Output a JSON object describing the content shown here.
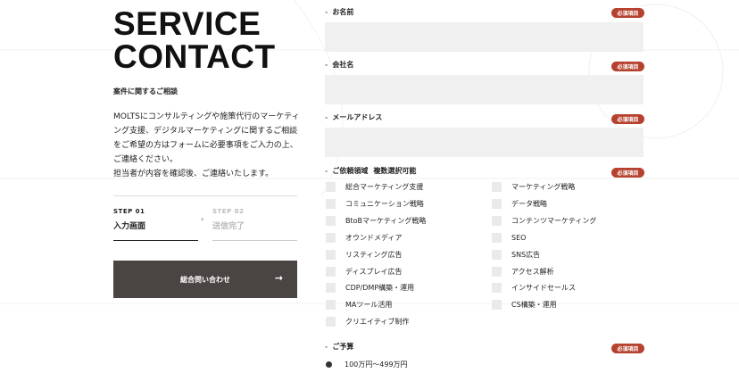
{
  "heading": {
    "line1": "SERVICE",
    "line2": "CONTACT"
  },
  "subtitle": "案件に関するご相談",
  "description": {
    "p1": "MOLTSにコンサルティングや施策代行のマーケティング支援、デジタルマーケティングに関するご相談をご希望の方はフォームに必要事項をご入力の上、ご連絡ください。",
    "p2": "担当者が内容を確認後、ご連絡いたします。"
  },
  "steps": [
    {
      "no": "STEP 01",
      "name": "入力画面"
    },
    {
      "no": "STEP 02",
      "name": "送信完了"
    }
  ],
  "submit": {
    "label": "総合問い合わせ",
    "icon": "arrow-right-icon"
  },
  "required_label": "必須項目",
  "fields": {
    "name": {
      "label": "お名前",
      "value": ""
    },
    "company": {
      "label": "会社名",
      "value": ""
    },
    "email": {
      "label": "メールアドレス",
      "value": ""
    }
  },
  "categories": {
    "label": "ご依頼領域",
    "note": "複数選択可能",
    "left": [
      "総合マーケティング支援",
      "コミュニケーション戦略",
      "BtoBマーケティング戦略",
      "オウンドメディア",
      "リスティング広告",
      "ディスプレイ広告",
      "CDP/DMP構築・運用",
      "MAツール活用",
      "クリエイティブ制作"
    ],
    "right": [
      "マーケティング戦略",
      "データ戦略",
      "コンテンツマーケティング",
      "SEO",
      "SNS広告",
      "アクセス解析",
      "インサイドセールス",
      "CS構築・運用"
    ]
  },
  "budget": {
    "label": "ご予算",
    "options": [
      "100万円〜499万円"
    ]
  },
  "colors": {
    "accent": "#b5412e",
    "button": "#4a4442",
    "input_bg": "#f0f0f0"
  }
}
